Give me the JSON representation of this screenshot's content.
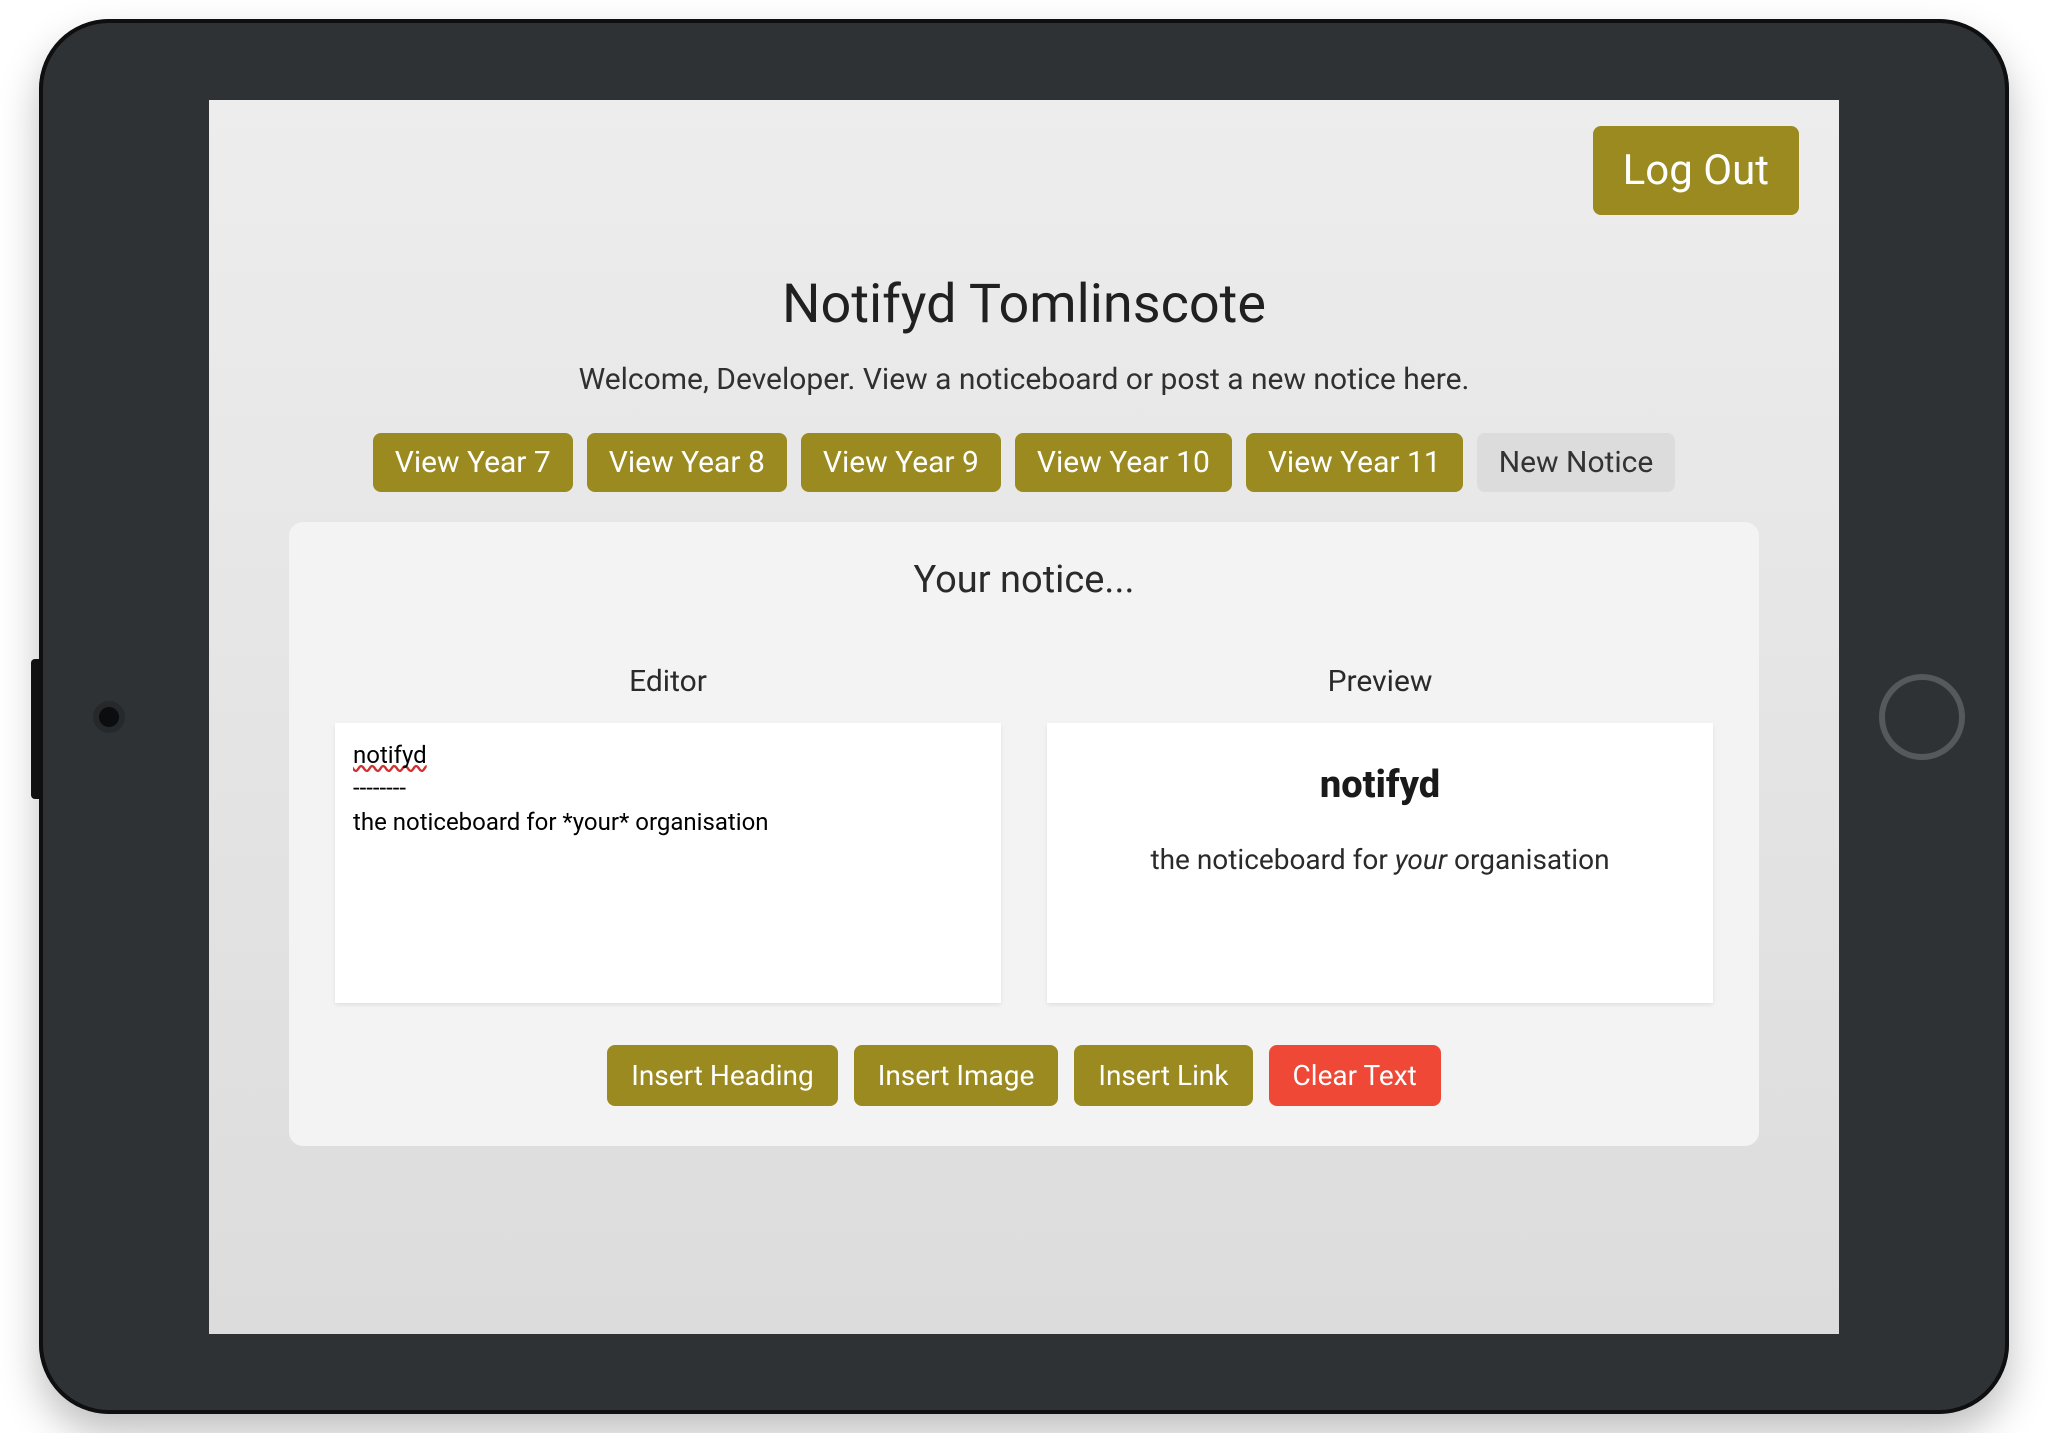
{
  "header": {
    "logout_label": "Log Out",
    "title": "Notifyd Tomlinscote",
    "welcome": "Welcome, Developer. View a noticeboard or post a new notice here."
  },
  "nav": {
    "items": [
      {
        "label": "View Year 7"
      },
      {
        "label": "View Year 8"
      },
      {
        "label": "View Year 9"
      },
      {
        "label": "View Year 10"
      },
      {
        "label": "View Year 11"
      }
    ],
    "new_notice_label": "New Notice"
  },
  "panel": {
    "heading": "Your notice...",
    "editor_label": "Editor",
    "preview_label": "Preview"
  },
  "editor": {
    "line1_word": "notifyd",
    "line2": "--------",
    "line3": "the noticeboard for *your* organisation",
    "raw": "notifyd\n--------\nthe noticeboard for *your* organisation"
  },
  "preview": {
    "heading": "notifyd",
    "body_before": "the noticeboard for ",
    "body_em": "your",
    "body_after": " organisation"
  },
  "tools": {
    "insert_heading": "Insert Heading",
    "insert_image": "Insert Image",
    "insert_link": "Insert Link",
    "clear_text": "Clear Text"
  },
  "colors": {
    "olive": "#9a8a1f",
    "red": "#ef4836"
  }
}
